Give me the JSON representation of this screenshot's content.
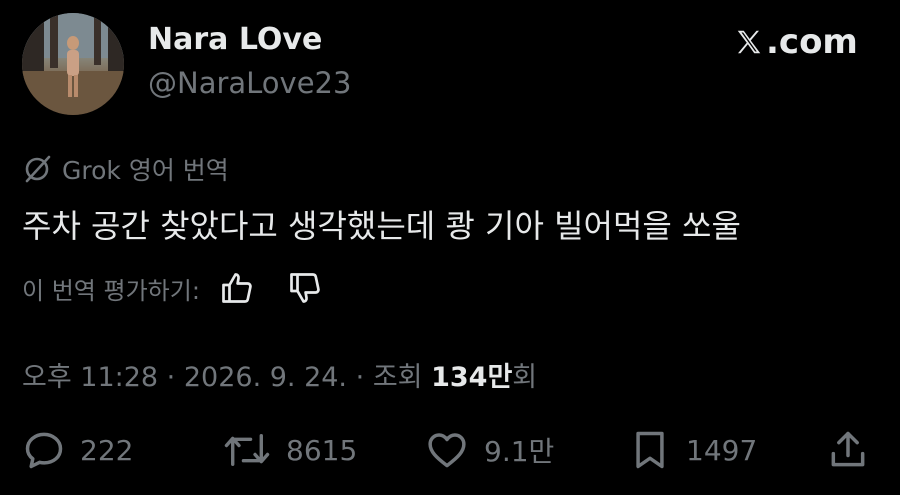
{
  "header": {
    "display_name": "Nara LOve",
    "handle": "@NaraLove23",
    "site_label": ".com"
  },
  "translation": {
    "label": "Grok 영어 번역",
    "tweet_text": "주차 공간 찾았다고 생각했는데 쾅 기아 빌어먹을 쏘울",
    "rate_label": "이 번역 평가하기:"
  },
  "meta": {
    "time": "오후 11:28",
    "date": "2026. 9. 24.",
    "views_prefix": "조회",
    "views_count": "134만",
    "views_suffix": "회",
    "separator": "·"
  },
  "actions": {
    "replies": "222",
    "reposts": "8615",
    "likes": "9.1만",
    "bookmarks": "1497"
  },
  "colors": {
    "background": "#000000",
    "text": "#e7e9ea",
    "muted": "#71767b"
  }
}
